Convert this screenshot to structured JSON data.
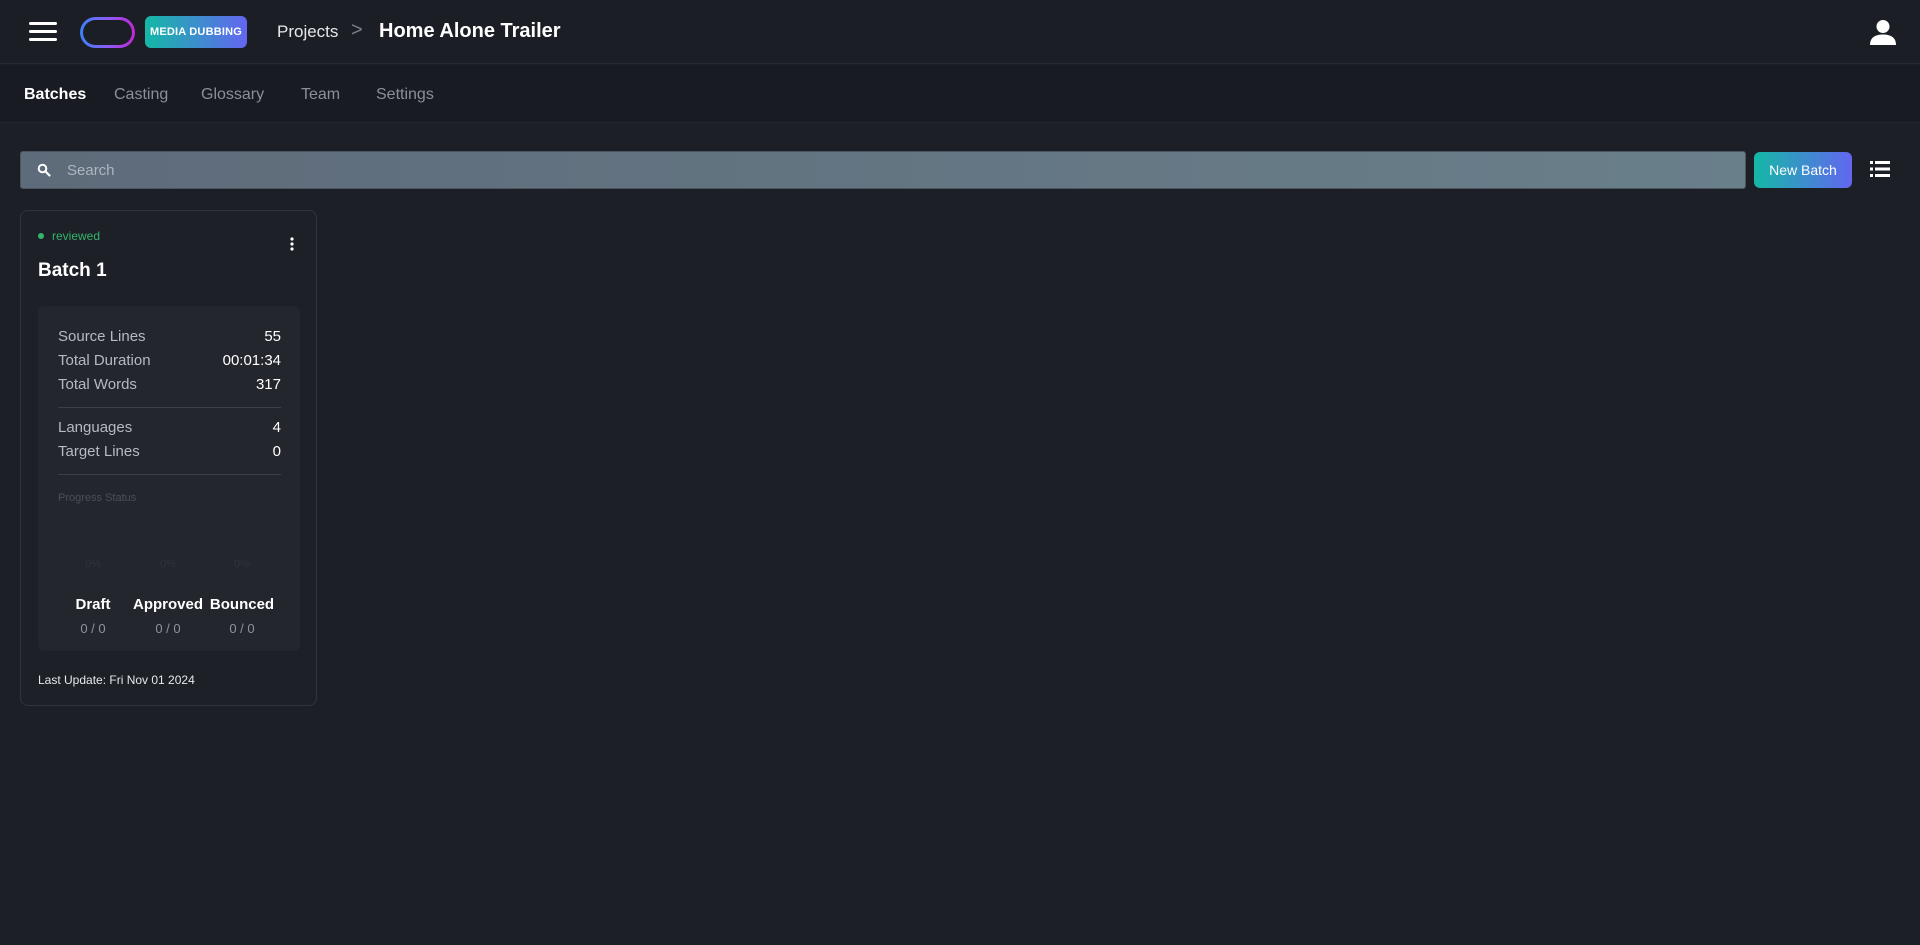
{
  "header": {
    "badge": "MEDIA DUBBING",
    "breadcrumb_projects": "Projects",
    "breadcrumb_separator": ">",
    "title": "Home Alone Trailer"
  },
  "tabs": [
    {
      "label": "Batches",
      "active": true
    },
    {
      "label": "Casting",
      "active": false
    },
    {
      "label": "Glossary",
      "active": false
    },
    {
      "label": "Team",
      "active": false
    },
    {
      "label": "Settings",
      "active": false
    }
  ],
  "toolbar": {
    "search_placeholder": "Search",
    "search_value": "",
    "new_batch_label": "New Batch"
  },
  "batch": {
    "status": "reviewed",
    "status_color": "#33b56a",
    "title": "Batch 1",
    "source_lines_label": "Source Lines",
    "source_lines": "55",
    "total_duration_label": "Total Duration",
    "total_duration": "00:01:34",
    "total_words_label": "Total Words",
    "total_words": "317",
    "languages_label": "Languages",
    "languages": "4",
    "target_lines_label": "Target Lines",
    "target_lines": "0",
    "progress_label": "Progress Status",
    "progress": [
      {
        "name": "Draft",
        "percent": "0%",
        "count": "0 / 0"
      },
      {
        "name": "Approved",
        "percent": "0%",
        "count": "0 / 0"
      },
      {
        "name": "Bounced",
        "percent": "0%",
        "count": "0 / 0"
      }
    ],
    "last_update": "Last Update: Fri Nov 01 2024"
  },
  "icons": {
    "menu": "hamburger-icon",
    "logo": "logo-pill",
    "user": "user-icon",
    "search": "search-icon",
    "list_view": "list-view-icon",
    "more": "more-vertical-icon"
  },
  "colors": {
    "background": "#1c1f26",
    "accent_gradient_start": "#14b8a6",
    "accent_gradient_end": "#6366f1"
  }
}
